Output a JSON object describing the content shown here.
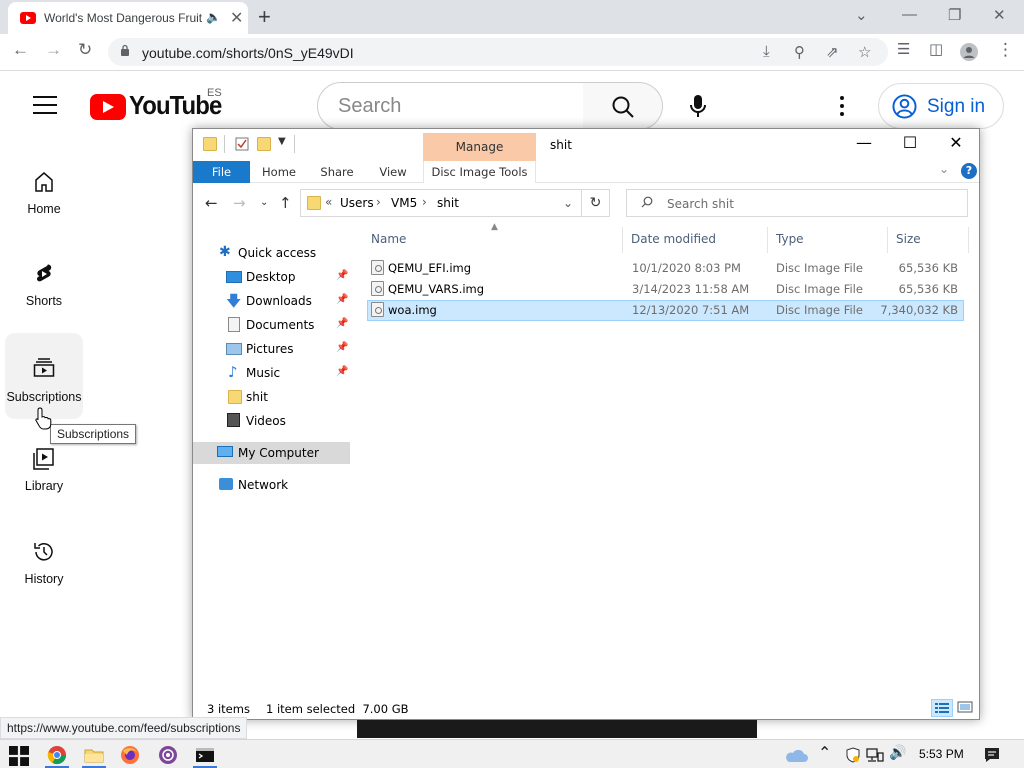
{
  "browser": {
    "tab_title": "World's Most Dangerous Fruit",
    "new_tab": "+",
    "url": "youtube.com/shorts/0nS_yE49vDI",
    "status_url": "https://www.youtube.com/feed/subscriptions"
  },
  "youtube": {
    "logo_text": "YouTube",
    "region": "ES",
    "search_placeholder": "Search",
    "sign_in": "Sign in",
    "nav": [
      {
        "label": "Home"
      },
      {
        "label": "Shorts"
      },
      {
        "label": "Subscriptions"
      },
      {
        "label": "Library"
      },
      {
        "label": "History"
      }
    ],
    "tooltip": "Subscriptions"
  },
  "explorer": {
    "window_title": "shit",
    "contextual_tab_group": "Manage",
    "ribbon_tabs": [
      "File",
      "Home",
      "Share",
      "View",
      "Disc Image Tools"
    ],
    "breadcrumb": [
      "Users",
      "VM5",
      "shit"
    ],
    "breadcrumb_overflow": "«",
    "search_placeholder": "Search shit",
    "nav_pane": [
      {
        "label": "Quick access",
        "icon": "star-icon"
      },
      {
        "label": "Desktop",
        "icon": "desktop-icon",
        "pinned": true
      },
      {
        "label": "Downloads",
        "icon": "download-icon",
        "pinned": true
      },
      {
        "label": "Documents",
        "icon": "documents-icon",
        "pinned": true
      },
      {
        "label": "Pictures",
        "icon": "pictures-icon",
        "pinned": true
      },
      {
        "label": "Music",
        "icon": "music-icon",
        "pinned": true
      },
      {
        "label": "shit",
        "icon": "folder-icon"
      },
      {
        "label": "Videos",
        "icon": "videos-icon"
      },
      {
        "label": "My Computer",
        "icon": "computer-icon"
      },
      {
        "label": "Network",
        "icon": "network-icon"
      }
    ],
    "columns": [
      "Name",
      "Date modified",
      "Type",
      "Size"
    ],
    "files": [
      {
        "name": "QEMU_EFI.img",
        "date": "10/1/2020 8:03 PM",
        "type": "Disc Image File",
        "size": "65,536 KB"
      },
      {
        "name": "QEMU_VARS.img",
        "date": "3/14/2023 11:58 AM",
        "type": "Disc Image File",
        "size": "65,536 KB"
      },
      {
        "name": "woa.img",
        "date": "12/13/2020 7:51 AM",
        "type": "Disc Image File",
        "size": "7,340,032 KB",
        "selected": true
      }
    ],
    "status": {
      "item_count": "3 items",
      "selection": "1 item selected  7.00 GB"
    }
  },
  "taskbar": {
    "clock": "5:53 PM"
  },
  "colors": {
    "youtube_red": "#ff0000",
    "link_blue": "#065fd4",
    "ribbon_file_blue": "#1979ca",
    "manage_highlight": "#f9c9a8",
    "selection_blue": "#cce8ff"
  }
}
